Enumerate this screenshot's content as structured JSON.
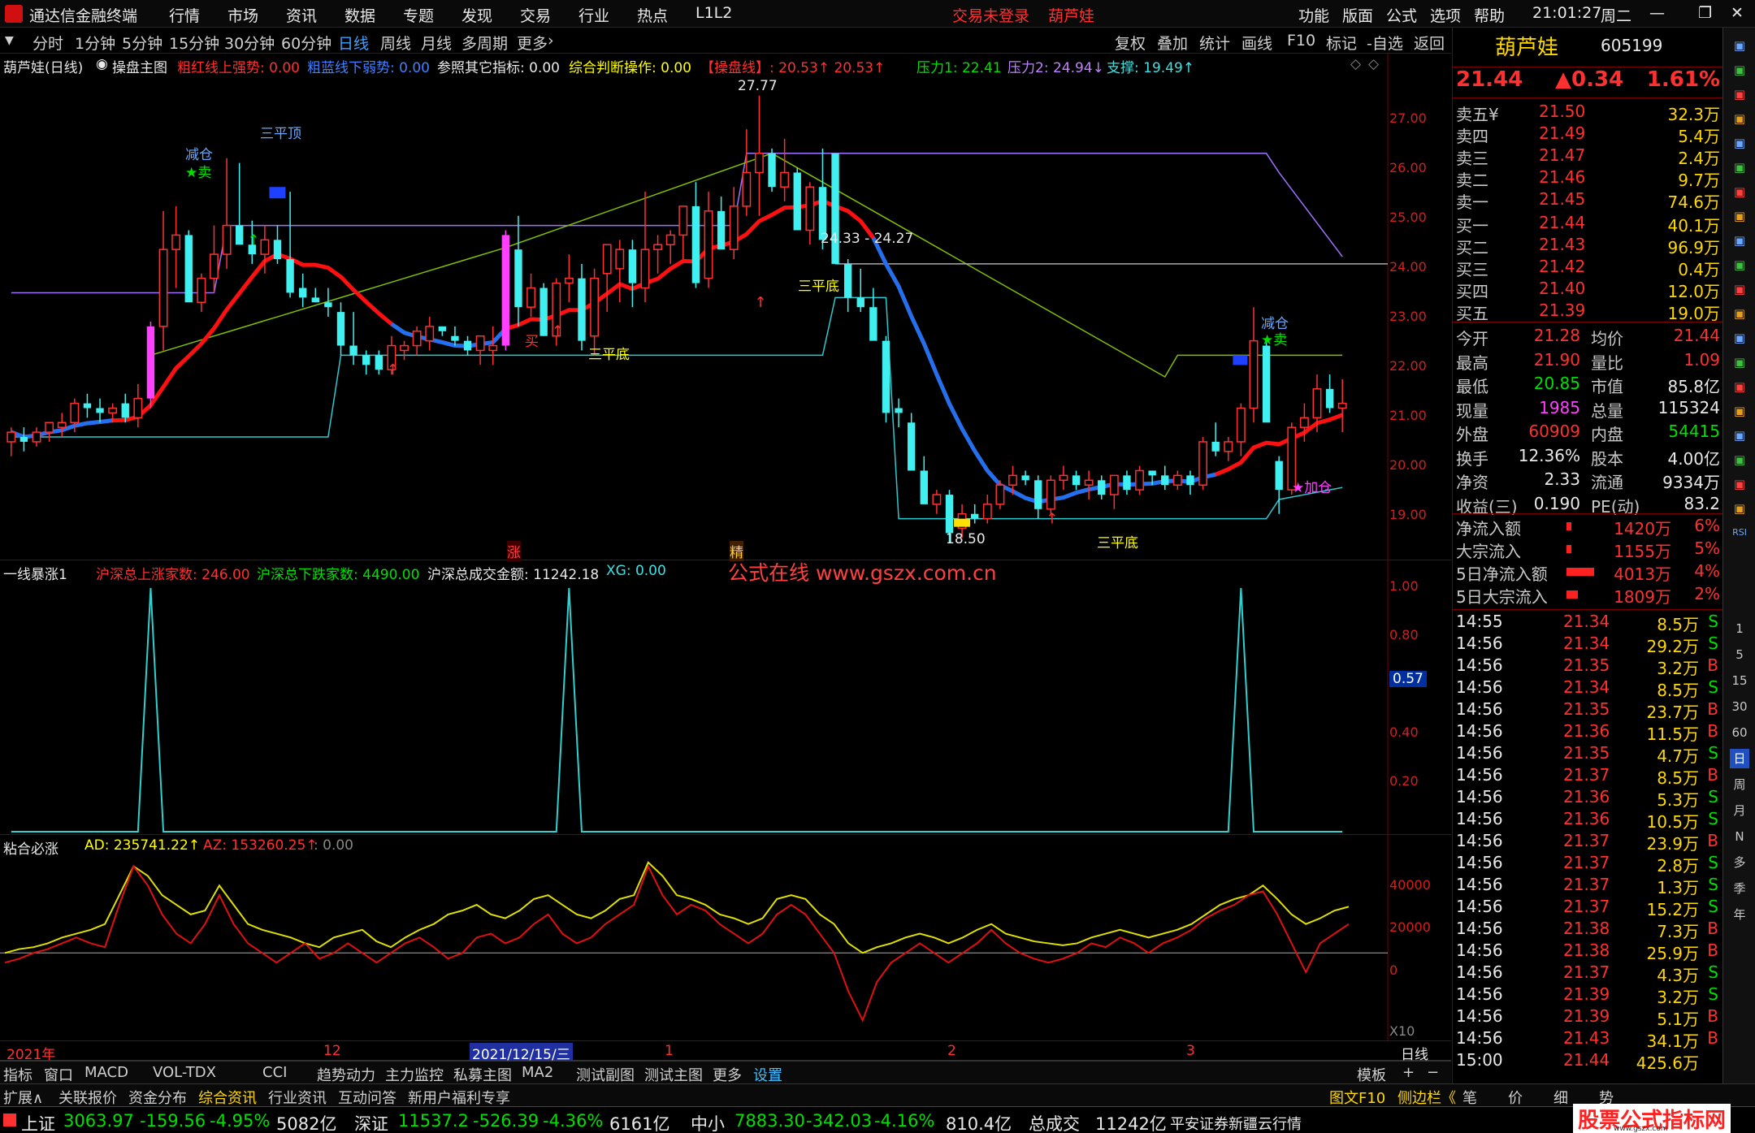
{
  "titlebar": {
    "app": "通达信金融终端",
    "menu": [
      "行情",
      "市场",
      "资讯",
      "数据",
      "专题",
      "发现",
      "交易",
      "行业",
      "热点",
      "L1L2"
    ],
    "login": "交易未登录",
    "stock": "葫芦娃",
    "right_menu": [
      "功能",
      "版面",
      "公式",
      "选项",
      "帮助"
    ],
    "time": "21:01:27",
    "weekday": "周二",
    "win_min": "—",
    "win_restore": "❐",
    "win_close": "✕"
  },
  "periodbar": {
    "items": [
      "分时",
      "1分钟",
      "5分钟",
      "15分钟",
      "30分钟",
      "60分钟",
      "日线",
      "周线",
      "月线",
      "多周期",
      "更多"
    ],
    "active": "日线",
    "right": [
      "复权",
      "叠加",
      "统计",
      "画线",
      "F10",
      "标记",
      "-自选",
      "返回"
    ]
  },
  "main_chart": {
    "title": "葫芦娃(日线)",
    "formula": "操盘主图",
    "ind1": "粗红线上强势: 0.00",
    "ind2": "粗蓝线下弱势: 0.00",
    "ind3": "参照其它指标: 0.00",
    "ind4": "综合判断操作: 0.00",
    "ind5": "【操盘线】: 20.53↑  20.53↑",
    "ind6": "压力1: 22.41",
    "ind7": "压力2: 24.94↓",
    "ind8": "支撑: 19.49↑",
    "yticks": [
      "27.00",
      "26.00",
      "25.00",
      "24.00",
      "23.00",
      "22.00",
      "21.00",
      "20.00",
      "19.00"
    ],
    "annotations": {
      "high": "27.77",
      "low": "18.50",
      "range": "24.33 - 24.27",
      "jiancang1": "减仓",
      "mai1": "★卖",
      "sanpingding": "三平顶",
      "sanpingdi1": "三平底",
      "sanpingdi2": "三平底",
      "sanpingdi3": "三平底",
      "jiancang2": "减仓",
      "mai2": "★卖",
      "jiacang": "★加仓",
      "mai_small": "买",
      "zhang": "涨",
      "jing": "精"
    }
  },
  "watermark": "公式在线  www.gszx.com.cn",
  "sub1": {
    "title": "一线暴涨1",
    "ind1": "沪深总上涨家数: 246.00",
    "ind2": "沪深总下跌家数: 4490.00",
    "ind3": "沪深总成交金额: 11242.18",
    "ind4": "XG: 0.00",
    "yticks": [
      "1.00",
      "0.80",
      "0.40",
      "0.20"
    ],
    "cursor": "0.57"
  },
  "sub2": {
    "title": "粘合必涨",
    "ind1": "AD: 235741.22↑",
    "ind2": "AZ: 153260.25↑",
    "ind3": ": 0.00",
    "yticks": [
      "40000",
      "20000",
      "0"
    ],
    "x10": "X10"
  },
  "xaxis": {
    "labels": [
      "2021年",
      "12",
      "2021/12/15/三",
      "1",
      "2",
      "3"
    ],
    "right": "日线"
  },
  "quote": {
    "name": "葫芦娃",
    "code": "605199",
    "price": "21.44",
    "change": "▲0.34",
    "pct": "1.61%",
    "asks": [
      [
        "卖五",
        "¥",
        "21.50",
        "32.3万"
      ],
      [
        "卖四",
        "",
        "21.49",
        "5.4万"
      ],
      [
        "卖三",
        "",
        "21.47",
        "2.4万"
      ],
      [
        "卖二",
        "",
        "21.46",
        "9.7万"
      ],
      [
        "卖一",
        "",
        "21.45",
        "74.6万"
      ]
    ],
    "bids": [
      [
        "买一",
        "21.44",
        "40.1万"
      ],
      [
        "买二",
        "21.43",
        "96.9万"
      ],
      [
        "买三",
        "21.42",
        "0.4万"
      ],
      [
        "买四",
        "21.40",
        "12.0万"
      ],
      [
        "买五",
        "21.39",
        "19.0万"
      ]
    ],
    "stats": [
      [
        "今开",
        "21.28",
        "均价",
        "21.44"
      ],
      [
        "最高",
        "21.90",
        "量比",
        "1.09"
      ],
      [
        "最低",
        "20.85",
        "市值",
        "85.8亿"
      ],
      [
        "现量",
        "1985",
        "总量",
        "115324"
      ],
      [
        "外盘",
        "60909",
        "内盘",
        "54415"
      ],
      [
        "换手",
        "12.36%",
        "股本",
        "4.00亿"
      ],
      [
        "净资",
        "2.33",
        "流通",
        "9334万"
      ],
      [
        "收益(三)",
        "0.190",
        "PE(动)",
        "83.2"
      ]
    ],
    "flows": [
      [
        "净流入额",
        "1420万",
        "6%"
      ],
      [
        "大宗流入",
        "1155万",
        "5%"
      ],
      [
        "5日净流入额",
        "4013万",
        "4%"
      ],
      [
        "5日大宗流入",
        "1809万",
        "2%"
      ]
    ],
    "ticks": [
      [
        "14:55",
        "21.34",
        "8.5万",
        "S"
      ],
      [
        "14:56",
        "21.34",
        "29.2万",
        "S"
      ],
      [
        "14:56",
        "21.35",
        "3.2万",
        "B"
      ],
      [
        "14:56",
        "21.34",
        "8.5万",
        "S"
      ],
      [
        "14:56",
        "21.35",
        "23.7万",
        "B"
      ],
      [
        "14:56",
        "21.36",
        "11.5万",
        "B"
      ],
      [
        "14:56",
        "21.35",
        "4.7万",
        "S"
      ],
      [
        "14:56",
        "21.37",
        "8.5万",
        "B"
      ],
      [
        "14:56",
        "21.36",
        "5.3万",
        "S"
      ],
      [
        "14:56",
        "21.36",
        "10.5万",
        "S"
      ],
      [
        "14:56",
        "21.37",
        "23.9万",
        "B"
      ],
      [
        "14:56",
        "21.37",
        "2.8万",
        "S"
      ],
      [
        "14:56",
        "21.37",
        "1.3万",
        "S"
      ],
      [
        "14:56",
        "21.37",
        "15.2万",
        "S"
      ],
      [
        "14:56",
        "21.38",
        "7.3万",
        "B"
      ],
      [
        "14:56",
        "21.38",
        "25.9万",
        "B"
      ],
      [
        "14:56",
        "21.37",
        "4.3万",
        "S"
      ],
      [
        "14:56",
        "21.39",
        "3.2万",
        "S"
      ],
      [
        "14:56",
        "21.39",
        "5.1万",
        "B"
      ],
      [
        "14:56",
        "21.43",
        "34.1万",
        "B"
      ],
      [
        "15:00",
        "21.44",
        "425.6万",
        ""
      ]
    ]
  },
  "toolstrip": [
    "1",
    "5",
    "15",
    "30",
    "60",
    "日",
    "周",
    "月",
    "N",
    "多",
    "季",
    "年"
  ],
  "toolstrip_icons": [
    "RSI"
  ],
  "tabs1": [
    "指标",
    "窗口",
    "MACD",
    "VOL-TDX",
    "CCI",
    "趋势动力",
    "主力监控",
    "私募主图",
    "MA2",
    "测试副图",
    "测试主图",
    "更多",
    "设置"
  ],
  "tabs1_right": [
    "模板",
    "+",
    "−"
  ],
  "tabs2": [
    "扩展∧",
    "关联报价",
    "资金分布",
    "综合资讯",
    "行业资讯",
    "互动问答",
    "新用户福利专享"
  ],
  "tabs2_right": [
    "图文F10",
    "侧边栏《",
    "笔",
    "价",
    "细",
    "势"
  ],
  "status": {
    "sh_name": "上证",
    "sh_val": "3063.97",
    "sh_chg": "-159.56",
    "sh_pct": "-4.95%",
    "sh_amt": "5082亿",
    "sz_name": "深证",
    "sz_val": "11537.2",
    "sz_chg": "-526.39",
    "sz_pct": "-4.36%",
    "sz_amt": "6161亿",
    "zx_name": "中小",
    "zx_val": "7883.30",
    "zx_chg": "-342.03",
    "zx_pct": "-4.16%",
    "zx_amt": "810.4亿",
    "total_lbl": "总成交",
    "total": "11242亿",
    "broker": "平安证券新疆云行情",
    "logo": "股票公式指标网",
    "logo_url": "www.gszx.com"
  },
  "chart_data": {
    "type": "candlestick",
    "ylim": [
      18.2,
      28.1
    ],
    "candles": [
      [
        20.6,
        20.9,
        20.3,
        20.8
      ],
      [
        20.7,
        20.9,
        20.4,
        20.6
      ],
      [
        20.6,
        20.9,
        20.5,
        20.8
      ],
      [
        20.8,
        21.0,
        20.6,
        21.0
      ],
      [
        20.9,
        21.2,
        20.7,
        21.0
      ],
      [
        21.0,
        21.5,
        20.8,
        21.4
      ],
      [
        21.4,
        21.6,
        21.1,
        21.3
      ],
      [
        21.3,
        21.5,
        21.0,
        21.2
      ],
      [
        21.2,
        21.4,
        21.0,
        21.3
      ],
      [
        21.4,
        21.6,
        21.0,
        21.1
      ],
      [
        21.1,
        21.8,
        20.9,
        21.5
      ],
      [
        21.5,
        23.1,
        21.3,
        23.0
      ],
      [
        23.0,
        25.4,
        22.5,
        24.6
      ],
      [
        24.6,
        25.5,
        23.8,
        24.9
      ],
      [
        24.9,
        25.0,
        23.6,
        23.5
      ],
      [
        23.5,
        24.1,
        23.3,
        24.0
      ],
      [
        24.0,
        25.1,
        23.7,
        24.5
      ],
      [
        24.5,
        26.5,
        24.2,
        25.1
      ],
      [
        25.1,
        26.4,
        24.8,
        24.7
      ],
      [
        24.7,
        25.2,
        24.3,
        24.5
      ],
      [
        24.5,
        25.1,
        24.1,
        24.8
      ],
      [
        24.8,
        25.1,
        24.3,
        24.4
      ],
      [
        24.4,
        25.8,
        23.6,
        23.7
      ],
      [
        23.8,
        24.1,
        23.4,
        23.6
      ],
      [
        23.6,
        23.8,
        23.5,
        23.5
      ],
      [
        23.5,
        23.8,
        23.2,
        23.4
      ],
      [
        23.3,
        23.5,
        22.4,
        22.6
      ],
      [
        22.6,
        23.3,
        22.2,
        22.4
      ],
      [
        22.4,
        22.5,
        22.0,
        22.2
      ],
      [
        22.4,
        22.5,
        22.0,
        22.1
      ],
      [
        22.1,
        22.8,
        22.0,
        22.6
      ],
      [
        22.5,
        22.7,
        22.3,
        22.6
      ],
      [
        22.6,
        23.0,
        22.4,
        22.9
      ],
      [
        22.7,
        23.2,
        22.5,
        23.0
      ],
      [
        23.0,
        23.0,
        22.8,
        22.9
      ],
      [
        22.8,
        23.0,
        22.6,
        22.7
      ],
      [
        22.7,
        22.8,
        22.4,
        22.5
      ],
      [
        22.5,
        22.8,
        22.2,
        22.8
      ],
      [
        22.5,
        23.0,
        22.2,
        22.6
      ],
      [
        22.6,
        25.0,
        22.5,
        24.9
      ],
      [
        24.6,
        25.3,
        23.0,
        23.4
      ],
      [
        23.4,
        24.1,
        23.2,
        23.8
      ],
      [
        23.8,
        23.9,
        22.8,
        22.8
      ],
      [
        22.8,
        24.0,
        22.6,
        23.9
      ],
      [
        23.9,
        24.5,
        23.5,
        24.0
      ],
      [
        24.0,
        24.3,
        22.5,
        22.7
      ],
      [
        22.8,
        24.2,
        22.4,
        24.0
      ],
      [
        24.1,
        24.5,
        23.3,
        24.7
      ],
      [
        24.2,
        24.8,
        23.5,
        24.6
      ],
      [
        24.6,
        24.8,
        23.4,
        23.9
      ],
      [
        23.8,
        25.8,
        23.5,
        24.6
      ],
      [
        24.6,
        24.9,
        24.1,
        24.7
      ],
      [
        24.7,
        25.0,
        24.3,
        24.9
      ],
      [
        24.9,
        25.5,
        24.4,
        25.5
      ],
      [
        25.5,
        26.0,
        23.8,
        23.9
      ],
      [
        24.0,
        25.8,
        23.8,
        25.4
      ],
      [
        25.4,
        25.7,
        24.6,
        24.6
      ],
      [
        24.6,
        25.9,
        24.4,
        25.5
      ],
      [
        25.5,
        27.1,
        25.3,
        26.2
      ],
      [
        26.2,
        27.8,
        25.3,
        26.6
      ],
      [
        26.6,
        26.7,
        25.8,
        25.9
      ],
      [
        25.9,
        26.9,
        25.6,
        26.2
      ],
      [
        26.2,
        26.3,
        25.1,
        25.0
      ],
      [
        25.0,
        26.0,
        24.7,
        25.9
      ],
      [
        25.9,
        26.7,
        24.6,
        24.8
      ],
      [
        26.6,
        26.6,
        24.3,
        24.3
      ],
      [
        24.3,
        24.4,
        23.3,
        23.6
      ],
      [
        23.6,
        24.2,
        23.3,
        23.4
      ],
      [
        23.4,
        23.8,
        22.8,
        22.7
      ],
      [
        22.7,
        22.8,
        21.0,
        21.2
      ],
      [
        21.3,
        21.5,
        20.9,
        21.2
      ],
      [
        21.0,
        21.2,
        20.1,
        20.0
      ],
      [
        20.0,
        20.3,
        19.4,
        19.3
      ],
      [
        19.3,
        19.6,
        19.1,
        19.5
      ],
      [
        19.5,
        19.6,
        18.5,
        18.7
      ],
      [
        18.8,
        19.3,
        18.6,
        19.1
      ],
      [
        19.1,
        19.3,
        18.9,
        19.0
      ],
      [
        19.0,
        19.5,
        18.9,
        19.3
      ],
      [
        19.3,
        19.8,
        19.2,
        19.7
      ],
      [
        19.7,
        20.1,
        19.5,
        19.9
      ],
      [
        19.9,
        20.0,
        19.7,
        19.8
      ],
      [
        19.8,
        19.9,
        19.0,
        19.2
      ],
      [
        19.2,
        19.9,
        19.1,
        19.8
      ],
      [
        19.8,
        20.1,
        19.6,
        19.9
      ],
      [
        19.9,
        20.0,
        19.6,
        19.7
      ],
      [
        19.7,
        20.0,
        19.4,
        19.8
      ],
      [
        19.8,
        19.9,
        19.4,
        19.5
      ],
      [
        19.5,
        19.9,
        19.2,
        19.9
      ],
      [
        19.9,
        20.0,
        19.5,
        19.6
      ],
      [
        19.6,
        20.1,
        19.5,
        20.0
      ],
      [
        20.0,
        20.0,
        19.7,
        19.9
      ],
      [
        19.9,
        20.1,
        19.6,
        19.7
      ],
      [
        19.7,
        20.0,
        19.6,
        19.9
      ],
      [
        19.9,
        20.0,
        19.5,
        19.7
      ],
      [
        19.7,
        20.7,
        19.6,
        20.6
      ],
      [
        20.6,
        21.0,
        20.3,
        20.4
      ],
      [
        20.4,
        20.7,
        20.2,
        20.6
      ],
      [
        20.6,
        21.4,
        20.3,
        21.3
      ],
      [
        21.3,
        23.4,
        21.0,
        22.7
      ],
      [
        22.6,
        22.7,
        21.1,
        21.0
      ],
      [
        20.2,
        20.3,
        19.1,
        19.6
      ],
      [
        19.6,
        21.0,
        19.5,
        20.9
      ],
      [
        20.9,
        21.4,
        20.6,
        21.1
      ],
      [
        21.1,
        22.0,
        20.8,
        21.7
      ],
      [
        21.7,
        22.0,
        21.2,
        21.3
      ],
      [
        21.3,
        21.9,
        20.8,
        21.4
      ]
    ],
    "sub1_spikes": [
      11,
      44,
      97
    ],
    "sub2_ad": [
      0,
      2000,
      3000,
      5000,
      8000,
      10000,
      12000,
      15000,
      30000,
      45000,
      40000,
      30000,
      25000,
      20000,
      22000,
      35000,
      25000,
      15000,
      12000,
      10000,
      8000,
      5000,
      3000,
      8000,
      10000,
      12000,
      6000,
      3000,
      8000,
      12000,
      15000,
      20000,
      22000,
      25000,
      20000,
      18000,
      22000,
      28000,
      30000,
      25000,
      20000,
      18000,
      22000,
      28000,
      30000,
      47000,
      40000,
      30000,
      28000,
      25000,
      20000,
      18000,
      15000,
      18000,
      28000,
      30000,
      28000,
      20000,
      15000,
      5000,
      0,
      3000,
      5000,
      8000,
      10000,
      8000,
      5000,
      8000,
      12000,
      15000,
      10000,
      8000,
      6000,
      5000,
      4000,
      5000,
      8000,
      10000,
      12000,
      10000,
      8000,
      10000,
      12000,
      15000,
      20000,
      25000,
      28000,
      30000,
      35000,
      28000,
      20000,
      15000,
      18000,
      22000,
      24000
    ],
    "sub2_az": [
      -5000,
      -3000,
      0,
      2000,
      5000,
      8000,
      5000,
      3000,
      25000,
      45000,
      35000,
      20000,
      10000,
      5000,
      15000,
      30000,
      15000,
      5000,
      0,
      -5000,
      0,
      5000,
      -3000,
      0,
      5000,
      0,
      -5000,
      0,
      5000,
      8000,
      3000,
      -3000,
      0,
      8000,
      10000,
      5000,
      8000,
      15000,
      20000,
      10000,
      5000,
      8000,
      15000,
      20000,
      25000,
      45000,
      30000,
      20000,
      25000,
      22000,
      15000,
      10000,
      5000,
      10000,
      20000,
      25000,
      20000,
      10000,
      0,
      -20000,
      -35000,
      -15000,
      -5000,
      0,
      5000,
      0,
      -5000,
      0,
      5000,
      12000,
      5000,
      0,
      -3000,
      -5000,
      -3000,
      0,
      5000,
      3000,
      8000,
      5000,
      0,
      5000,
      8000,
      12000,
      18000,
      22000,
      25000,
      30000,
      32000,
      20000,
      5000,
      -10000,
      5000,
      10000,
      15000
    ]
  }
}
